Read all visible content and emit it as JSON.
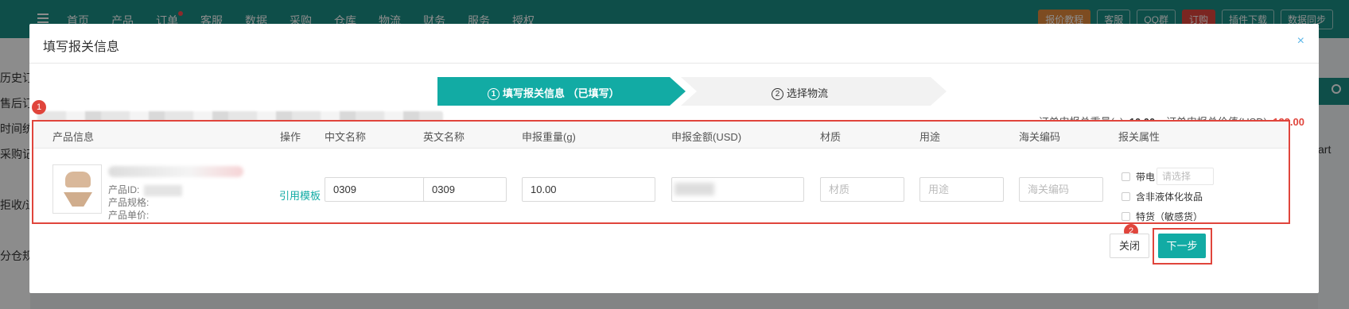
{
  "background": {
    "nav": [
      "首页",
      "产品",
      "订单",
      "客服",
      "数据",
      "采购",
      "仓库",
      "物流",
      "财务",
      "服务",
      "授权"
    ],
    "top_right": [
      "报价教程",
      "客服",
      "QQ群",
      "订购",
      "插件下载",
      "数据同步"
    ],
    "left_items": [
      "历史订单",
      "售后订单",
      "时间统计",
      "采购记录",
      "拒收/退",
      "分仓规则"
    ],
    "right_text": "art"
  },
  "modal": {
    "title": "填写报关信息",
    "close_glyph": "×",
    "steps": [
      {
        "num": "1",
        "label": "填写报关信息 （已填写）"
      },
      {
        "num": "2",
        "label": "选择物流"
      }
    ],
    "summary": {
      "weight_label": "订单申报总重量(g):",
      "weight_value": "10.00",
      "value_label": "订单申报总价值(USD):",
      "value_value": "123.00"
    },
    "markers": [
      "1",
      "2"
    ],
    "table": {
      "headers": [
        "产品信息",
        "操作",
        "中文名称",
        "英文名称",
        "申报重量(g)",
        "申报金额(USD)",
        "材质",
        "用途",
        "海关编码",
        "报关属性"
      ],
      "row": {
        "id_label": "产品ID:",
        "spec_label": "产品规格:",
        "price_label": "产品单价:",
        "action": "引用模板",
        "cn_name": "0309",
        "en_name": "0309",
        "weight": "10.00",
        "amount": "",
        "material_placeholder": "材质",
        "usage_placeholder": "用途",
        "hs_placeholder": "海关编码",
        "attrs": {
          "battery": "带电",
          "select_placeholder": "请选择",
          "liquid": "含非液体化妆品",
          "special": "特货（敏感货）"
        }
      }
    },
    "buttons": {
      "close": "关闭",
      "next": "下一步"
    }
  },
  "colors": {
    "teal": "#12aba4",
    "red": "#e0453c",
    "header_teal": "#1b8f86"
  }
}
